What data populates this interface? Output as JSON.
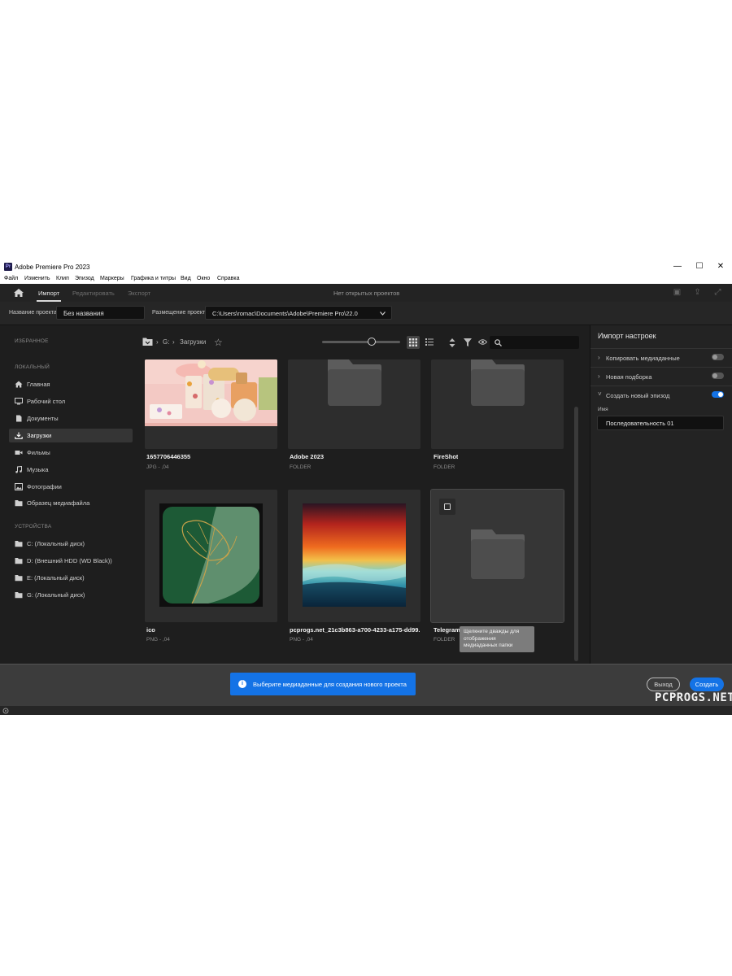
{
  "window": {
    "title": "Adobe Premiere Pro 2023",
    "app_icon_text": "Pr",
    "controls": {
      "minimize": "—",
      "maximize": "☐",
      "close": "✕"
    }
  },
  "menu": [
    "Файл",
    "Изменить",
    "Клип",
    "Эпизод",
    "Маркеры",
    "Графика и титры",
    "Вид",
    "Окно",
    "Справка"
  ],
  "nav": {
    "tabs": [
      "Импорт",
      "Редактировать",
      "Экспорт"
    ],
    "active_tab": "Импорт",
    "center_title": "Нет открытых проектов"
  },
  "project": {
    "name_label": "Название проекта",
    "name_value": "Без названия",
    "location_label": "Размещение проекта",
    "location_value": "C:\\Users\\romac\\Documents\\Adobe\\Premiere Pro\\22.0"
  },
  "sidebar": {
    "favorites_label": "ИЗБРАННОЕ",
    "local_label": "ЛОКАЛЬНЫЙ",
    "local_items": [
      "Главная",
      "Рабочий стол",
      "Документы",
      "Загрузки",
      "Фильмы",
      "Музыка",
      "Фотографии",
      "Образец медиафайла"
    ],
    "active_item": "Загрузки",
    "devices_label": "УСТРОЙСТВА",
    "device_items": [
      "C: (Локальный диск)",
      "D: (Внешний HDD (WD Black))",
      "E: (Локальный диск)",
      "G: (Локальный диск)"
    ]
  },
  "breadcrumb": {
    "drive": "G:",
    "folder": "Загрузки",
    "sep": "›"
  },
  "files": [
    {
      "name": "1657706446355",
      "meta": "JPG - ,04",
      "kind": "image-soap"
    },
    {
      "name": "Adobe 2023",
      "meta": "FOLDER",
      "kind": "folder"
    },
    {
      "name": "FireShot",
      "meta": "FOLDER",
      "kind": "folder"
    },
    {
      "name": "ico",
      "meta": "PNG - ,04",
      "kind": "image-leaf"
    },
    {
      "name": "pcprogs.net_21c3b863-a700-4233-a175-dd99...",
      "meta": "PNG - ,04",
      "kind": "image-sunset"
    },
    {
      "name": "Telegram",
      "meta": "FOLDER",
      "kind": "folder"
    }
  ],
  "tooltip": "Щелкните дважды для отображения медиаданных папки",
  "import_settings": {
    "title": "Импорт настроек",
    "copy_media": "Копировать медиаданные",
    "copy_media_on": false,
    "new_bin": "Новая подборка",
    "new_bin_on": false,
    "new_sequence": "Создать новый эпизод",
    "new_sequence_on": true,
    "name_label": "Имя",
    "name_value": "Последовательность 01"
  },
  "footer": {
    "notice": "Выберите медиаданные для создания нового проекта",
    "exit_label": "Выход",
    "create_label": "Создать",
    "watermark": "PCPROGS.NET"
  },
  "colors": {
    "accent": "#1473e6",
    "panel": "#1e1e1e",
    "tile": "#2d2d2d"
  }
}
